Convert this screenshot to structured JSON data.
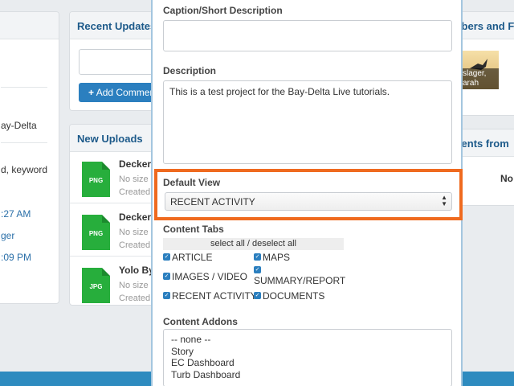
{
  "left_panel": {
    "lines": [
      "ay-Delta",
      "d, keyword",
      ":27 AM",
      "ger",
      ":09 PM"
    ]
  },
  "recent_updates": {
    "title": "Recent Updates",
    "add_comment_label": "Add Comment",
    "add_icon": "plus-icon"
  },
  "new_uploads": {
    "title": "New Uploads",
    "items": [
      {
        "name": "Decker",
        "type": "PNG",
        "size": "No size a",
        "created": "Created:"
      },
      {
        "name": "Decker",
        "type": "PNG",
        "size": "No size a",
        "created": "Created:"
      },
      {
        "name": "Yolo By",
        "type": "JPG",
        "size": "No size a",
        "created": "Created:"
      }
    ]
  },
  "members": {
    "title": "mbers and Fo",
    "avatar_caption_1": "slager,",
    "avatar_caption_2": "arah"
  },
  "comments_panel": {
    "title": "ments from",
    "none_text": "No c"
  },
  "modal": {
    "caption_label": "Caption/Short Description",
    "caption_value": "",
    "description_label": "Description",
    "description_value": "This is a test project for the Bay-Delta Live tutorials.",
    "default_view_label": "Default View",
    "default_view_value": "RECENT ACTIVITY",
    "content_tabs_label": "Content Tabs",
    "select_all_label": "select all / deselect all",
    "tabs": [
      {
        "label": "ARTICLE",
        "checked": true
      },
      {
        "label": "MAPS",
        "checked": true
      },
      {
        "label": "IMAGES / VIDEO",
        "checked": true
      },
      {
        "label": "SUMMARY/REPORT",
        "checked": true
      },
      {
        "label": "RECENT ACTIVITY",
        "checked": true
      },
      {
        "label": "DOCUMENTS",
        "checked": true
      }
    ],
    "content_addons_label": "Content Addons",
    "addons": [
      "-- none --",
      "Story",
      "EC Dashboard",
      "Turb Dashboard"
    ]
  },
  "colors": {
    "accent": "#2b7fbf",
    "highlight": "#ef6a1f",
    "file_icon": "#27ae3c",
    "heading": "#1d5a8a"
  }
}
